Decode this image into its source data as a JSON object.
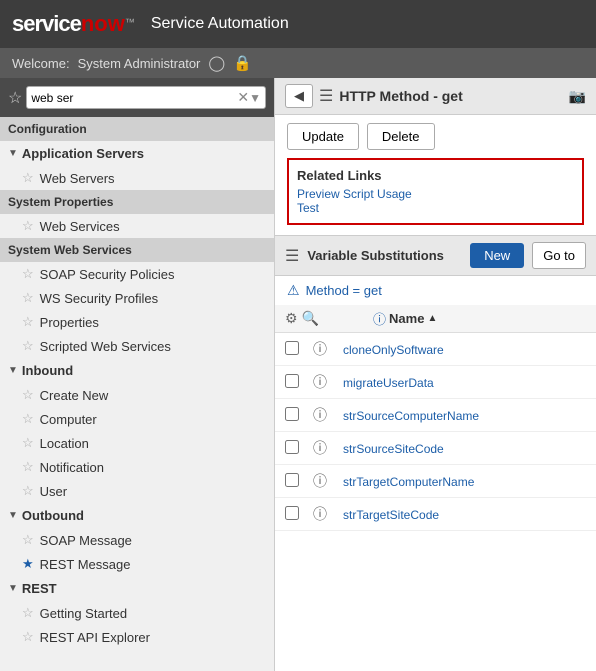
{
  "header": {
    "logo_service": "service",
    "logo_now": "now",
    "logo_tm": "™",
    "title": "Service Automation"
  },
  "welcome_bar": {
    "label": "Welcome:",
    "user": "System Administrator"
  },
  "sidebar": {
    "search_value": "web ser",
    "search_placeholder": "Search",
    "sections": [
      {
        "type": "section-header",
        "label": "Configuration"
      },
      {
        "type": "group",
        "label": "Application Servers",
        "expanded": true
      },
      {
        "type": "item",
        "label": "Web Servers",
        "star": false
      },
      {
        "type": "section-header",
        "label": "System Properties"
      },
      {
        "type": "item",
        "label": "Web Services",
        "star": false
      },
      {
        "type": "section-header",
        "label": "System Web Services"
      },
      {
        "type": "item",
        "label": "SOAP Security Policies",
        "star": false
      },
      {
        "type": "item",
        "label": "WS Security Profiles",
        "star": false
      },
      {
        "type": "item",
        "label": "Properties",
        "star": false
      },
      {
        "type": "item",
        "label": "Scripted Web Services",
        "star": false
      },
      {
        "type": "group",
        "label": "Inbound",
        "expanded": true
      },
      {
        "type": "item",
        "label": "Create New",
        "star": false
      },
      {
        "type": "item",
        "label": "Computer",
        "star": false
      },
      {
        "type": "item",
        "label": "Location",
        "star": false
      },
      {
        "type": "item",
        "label": "Notification",
        "star": false
      },
      {
        "type": "item",
        "label": "User",
        "star": false
      },
      {
        "type": "group",
        "label": "Outbound",
        "expanded": true
      },
      {
        "type": "item",
        "label": "SOAP Message",
        "star": false
      },
      {
        "type": "item",
        "label": "REST Message",
        "star": true
      },
      {
        "type": "group",
        "label": "REST",
        "expanded": true
      },
      {
        "type": "item",
        "label": "Getting Started",
        "star": false
      },
      {
        "type": "item",
        "label": "REST API Explorer",
        "star": false
      }
    ]
  },
  "content": {
    "toolbar": {
      "title": "HTTP Method - get"
    },
    "buttons": {
      "update": "Update",
      "delete": "Delete"
    },
    "related_links": {
      "title": "Related Links",
      "links": [
        "Preview Script Usage",
        "Test"
      ]
    },
    "variable_substitutions": {
      "title": "Variable Substitutions",
      "new_label": "New",
      "goto_label": "Go to"
    },
    "filter": {
      "text": "Method = get"
    },
    "table": {
      "col_name": "Name",
      "sort_indicator": "▲",
      "rows": [
        {
          "name": "cloneOnlySoftware"
        },
        {
          "name": "migrateUserData"
        },
        {
          "name": "strSourceComputerName"
        },
        {
          "name": "strSourceSiteCode"
        },
        {
          "name": "strTargetComputerName"
        },
        {
          "name": "strTargetSiteCode"
        }
      ]
    }
  }
}
